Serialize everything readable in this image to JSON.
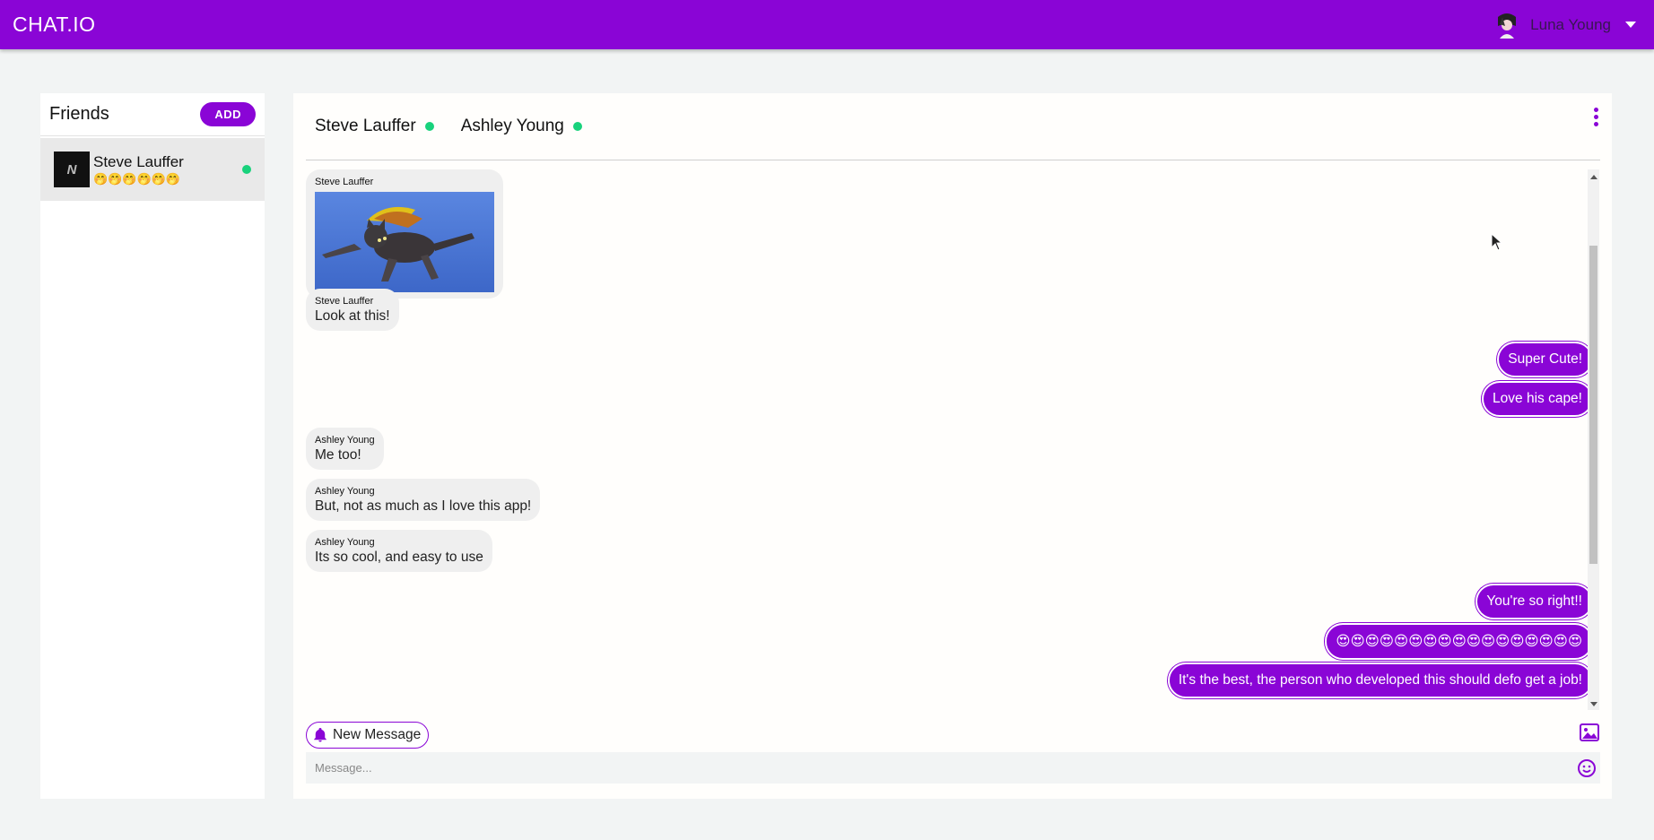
{
  "app": {
    "brand": "CHAT.IO",
    "user_name": "Luna Young"
  },
  "friends": {
    "title": "Friends",
    "add_label": "ADD",
    "items": [
      {
        "name": "Steve Lauffer",
        "status": "🤭🤭🤭🤭🤭🤭",
        "avatar_letter": "N",
        "online": true
      }
    ]
  },
  "chat": {
    "participants": [
      {
        "name": "Steve Lauffer",
        "online": true
      },
      {
        "name": "Ashley Young",
        "online": true
      }
    ],
    "messages": [
      {
        "direction": "in",
        "sender": "Steve Lauffer",
        "type": "image",
        "text": ""
      },
      {
        "direction": "in",
        "sender": "Steve Lauffer",
        "type": "text",
        "text": "Look at this!"
      },
      {
        "direction": "out",
        "type": "text",
        "text": "Super Cute!"
      },
      {
        "direction": "out",
        "type": "text",
        "text": "Love his cape!"
      },
      {
        "direction": "in",
        "sender": "Ashley Young",
        "type": "text",
        "text": "Me too!"
      },
      {
        "direction": "in",
        "sender": "Ashley Young",
        "type": "text",
        "text": "But, not as much as I love this app!"
      },
      {
        "direction": "in",
        "sender": "Ashley Young",
        "type": "text",
        "text": "Its so cool, and easy to use"
      },
      {
        "direction": "out",
        "type": "text",
        "text": "You're so right!!"
      },
      {
        "direction": "out",
        "type": "text",
        "text": "😍😍😍😍😍😍😍😍😍😍😍😍😍😍😍😍😍"
      },
      {
        "direction": "out",
        "type": "text",
        "text": "It's the best, the person who developed this should defo get a job!"
      }
    ],
    "notice_label": "New Message",
    "compose_placeholder": "Message..."
  },
  "icons": {
    "notice": "bell-icon",
    "attach": "image-icon",
    "emoji": "smile-icon",
    "menu": "kebab-menu-icon"
  },
  "colors": {
    "accent": "#8a05d6",
    "online": "#18d27c",
    "background": "#f2f4f4"
  }
}
